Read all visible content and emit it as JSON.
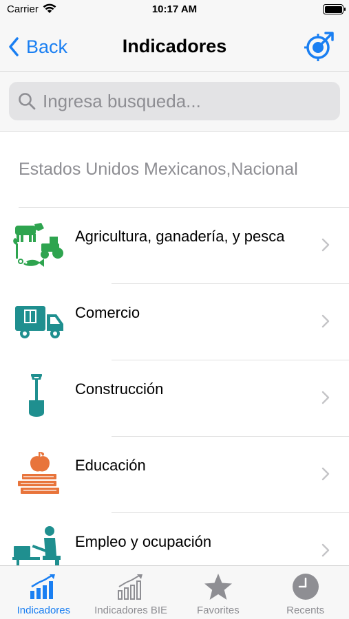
{
  "status_bar": {
    "carrier": "Carrier",
    "time": "10:17 AM"
  },
  "nav": {
    "back_label": "Back",
    "title": "Indicadores"
  },
  "search": {
    "placeholder": "Ingresa busqueda..."
  },
  "section": {
    "header": "Estados Unidos Mexicanos,Nacional"
  },
  "categories": [
    {
      "label": "Agricultura, ganadería, y pesca",
      "icon": "agriculture-icon",
      "color": "#2ea44f"
    },
    {
      "label": "Comercio",
      "icon": "delivery-truck-icon",
      "color": "#1f8f8f"
    },
    {
      "label": "Construcción",
      "icon": "shovel-icon",
      "color": "#1f8f8f"
    },
    {
      "label": "Educación",
      "icon": "apple-books-icon",
      "color": "#e8743b"
    },
    {
      "label": "Empleo y ocupación",
      "icon": "worker-desk-icon",
      "color": "#1f8f8f"
    }
  ],
  "tabs": [
    {
      "label": "Indicadores",
      "icon": "bar-chart-icon",
      "active": true
    },
    {
      "label": "Indicadores BIE",
      "icon": "bar-chart-outline-icon",
      "active": false
    },
    {
      "label": "Favorites",
      "icon": "star-icon",
      "active": false
    },
    {
      "label": "Recents",
      "icon": "clock-icon",
      "active": false
    }
  ],
  "colors": {
    "accent": "#1a7ff2",
    "inactive": "#8e8e93",
    "chevron": "#c4c4c7"
  }
}
